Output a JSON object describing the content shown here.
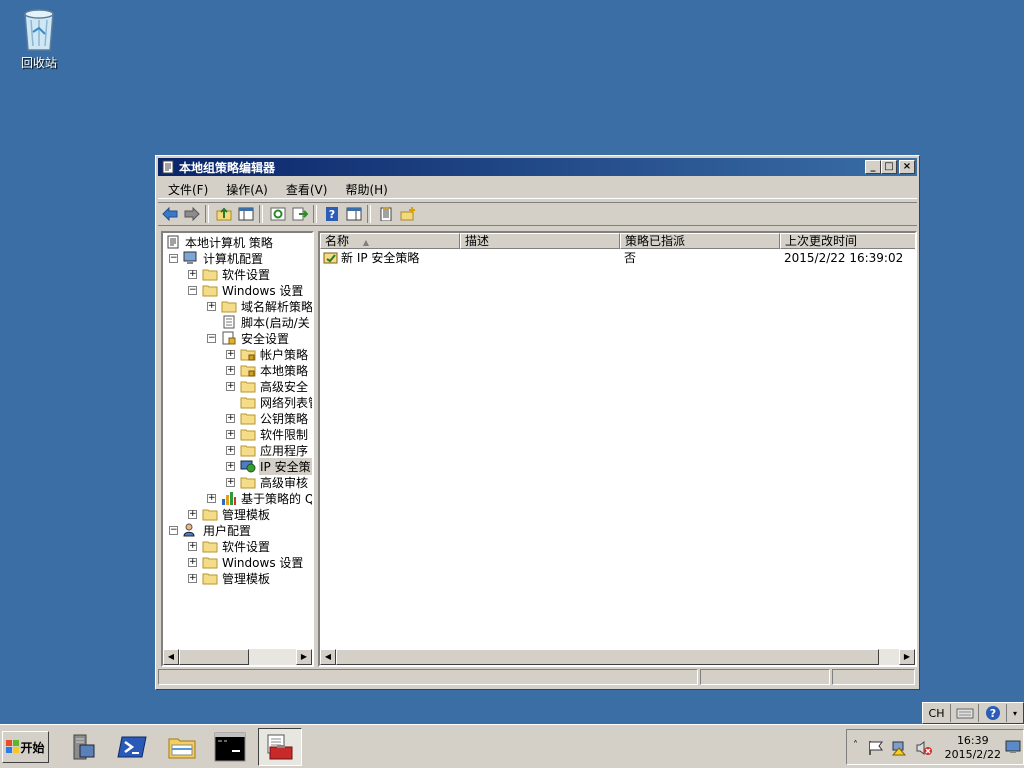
{
  "desktop": {
    "recycle_bin_label": "回收站"
  },
  "window": {
    "title": "本地组策略编辑器",
    "min_symbol": "_",
    "max_symbol": "□",
    "close_symbol": "×"
  },
  "menu": [
    "文件(F)",
    "操作(A)",
    "查看(V)",
    "帮助(H)"
  ],
  "toolbar_icons": [
    "back-icon",
    "forward-icon",
    "up-folder-icon",
    "show-hide-tree-icon",
    "refresh-icon",
    "export-list-icon",
    "help-icon",
    "show-hide-action-pane-icon",
    "properties-icon",
    "new-icon"
  ],
  "tree": {
    "root": "本地计算机 策略",
    "computer_config": "计算机配置",
    "software_settings": "软件设置",
    "windows_settings": "Windows 设置",
    "name_resolution_policy": "域名解析策略",
    "scripts": "脚本(启动/关",
    "security_settings": "安全设置",
    "account_policies": "帐户策略",
    "local_policies": "本地策略",
    "advanced_security": "高级安全",
    "network_list": "网络列表管",
    "public_key_policies": "公钥策略",
    "software_restriction": "软件限制",
    "app_control": "应用程序",
    "ip_security": "IP 安全策",
    "advanced_audit": "高级审核",
    "policy_qos": "基于策略的 Q",
    "admin_templates": "管理模板",
    "user_config": "用户配置",
    "user_software_settings": "软件设置",
    "user_windows_settings": "Windows 设置",
    "user_admin_templates": "管理模板"
  },
  "list": {
    "columns": [
      "名称",
      "描述",
      "策略已指派",
      "上次更改时间"
    ],
    "sort_indicator": "▲",
    "rows": [
      {
        "name": "新 IP 安全策略",
        "description": "",
        "assigned": "否",
        "modified": "2015/2/22 16:39:02"
      }
    ]
  },
  "taskbar": {
    "start_label": "开始",
    "apps": [
      "server-manager-icon",
      "powershell-icon",
      "explorer-icon",
      "cmd-icon",
      "gpedit-toolbox-icon"
    ],
    "clock_time": "16:39",
    "clock_date": "2015/2/22",
    "lang": "CH"
  }
}
